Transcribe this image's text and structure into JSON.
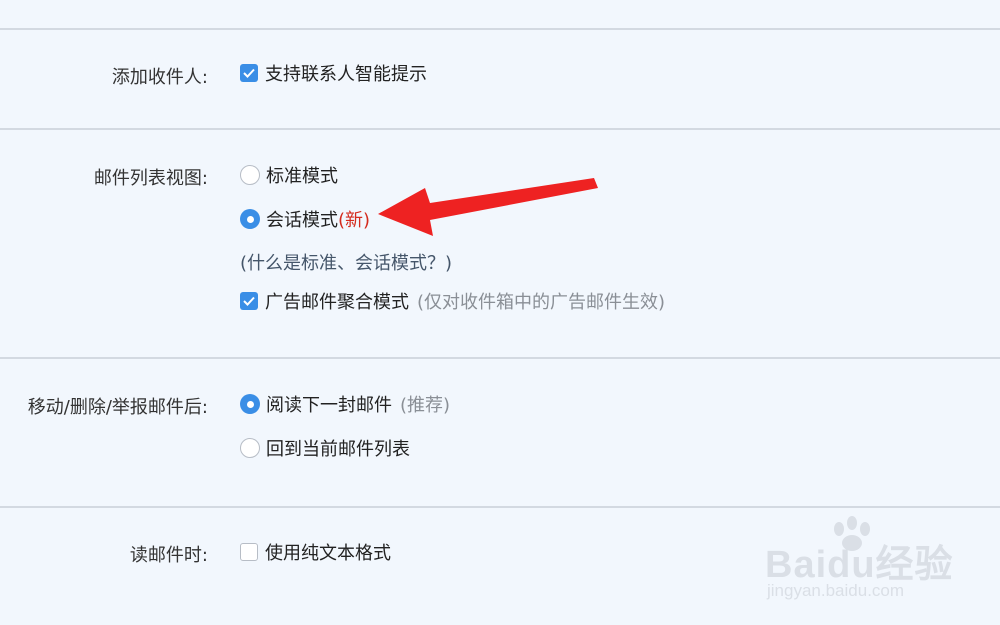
{
  "rows": {
    "recipient": {
      "label": "添加收件人:",
      "option_label": "支持联系人智能提示",
      "checked": true
    },
    "list_view": {
      "label": "邮件列表视图:",
      "standard_label": "标准模式",
      "conversation_label": "会话模式",
      "new_tag": "(新)",
      "selected": "conversation",
      "help_link": "(什么是标准、会话模式？)",
      "ad_label": "广告邮件聚合模式",
      "ad_hint": "(仅对收件箱中的广告邮件生效)",
      "ad_checked": true
    },
    "after_action": {
      "label": "移动/删除/举报邮件后:",
      "read_next_label": "阅读下一封邮件",
      "read_next_hint": "(推荐)",
      "back_to_list_label": "回到当前邮件列表",
      "selected": "read_next"
    },
    "reading": {
      "label": "读邮件时:",
      "plain_text_label": "使用纯文本格式",
      "checked": false
    }
  },
  "watermark": {
    "brand": "Baidu经验",
    "url": "jingyan.baidu.com"
  },
  "colors": {
    "background": "#f2f7fd",
    "accent": "#3a8ee6",
    "divider": "#d3d9e1",
    "new_tag": "#d42b1e",
    "arrow": "#ee2222"
  }
}
